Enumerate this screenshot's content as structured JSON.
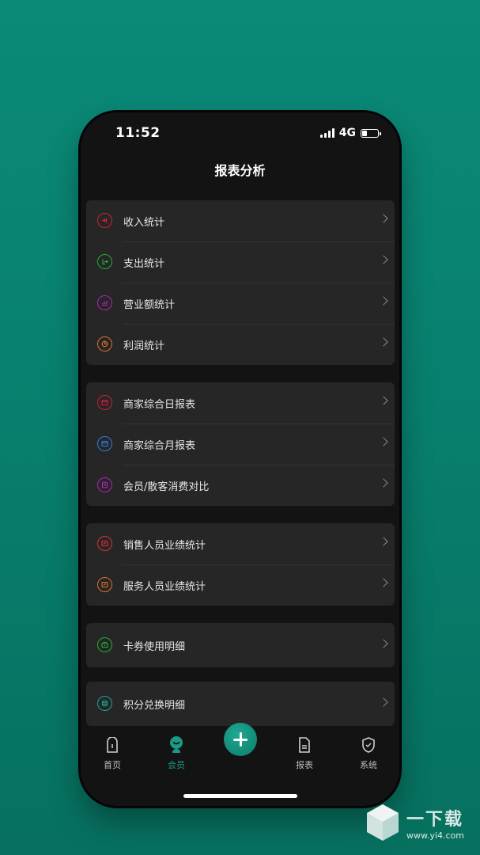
{
  "status": {
    "time": "11:52",
    "network": "4G",
    "battery_level": 0.35
  },
  "page": {
    "title": "报表分析"
  },
  "groups": [
    {
      "items": [
        {
          "label": "收入统计",
          "icon": "income-icon",
          "color": "#d0203a"
        },
        {
          "label": "支出统计",
          "icon": "expense-icon",
          "color": "#22b231"
        },
        {
          "label": "营业额统计",
          "icon": "turnover-icon",
          "color": "#b322b8"
        },
        {
          "label": "利润统计",
          "icon": "profit-pie-icon",
          "color": "#e0702a"
        }
      ]
    },
    {
      "items": [
        {
          "label": "商家综合日报表",
          "icon": "daily-report-icon",
          "color": "#d0203a"
        },
        {
          "label": "商家综合月报表",
          "icon": "monthly-report-icon",
          "color": "#2e7fe0"
        },
        {
          "label": "会员/散客消费对比",
          "icon": "compare-icon",
          "color": "#b322b8"
        }
      ]
    },
    {
      "items": [
        {
          "label": "销售人员业绩统计",
          "icon": "sales-staff-icon",
          "color": "#e0303a"
        },
        {
          "label": "服务人员业绩统计",
          "icon": "service-staff-icon",
          "color": "#e0702a"
        }
      ]
    },
    {
      "items": [
        {
          "label": "卡券使用明细",
          "icon": "coupon-icon",
          "color": "#22b231"
        }
      ]
    },
    {
      "items": [
        {
          "label": "积分兑换明细",
          "icon": "points-icon",
          "color": "#15a89a"
        }
      ]
    }
  ],
  "tabbar": {
    "items": [
      {
        "label": "首页",
        "icon": "home-icon"
      },
      {
        "label": "会员",
        "icon": "member-icon",
        "active": true,
        "color": "#1b9a86"
      },
      {
        "label": "",
        "icon": "add-icon"
      },
      {
        "label": "报表",
        "icon": "report-icon"
      },
      {
        "label": "系统",
        "icon": "system-shield-icon"
      }
    ]
  },
  "watermark": {
    "title": "一下载",
    "url": "www.yi4.com"
  }
}
